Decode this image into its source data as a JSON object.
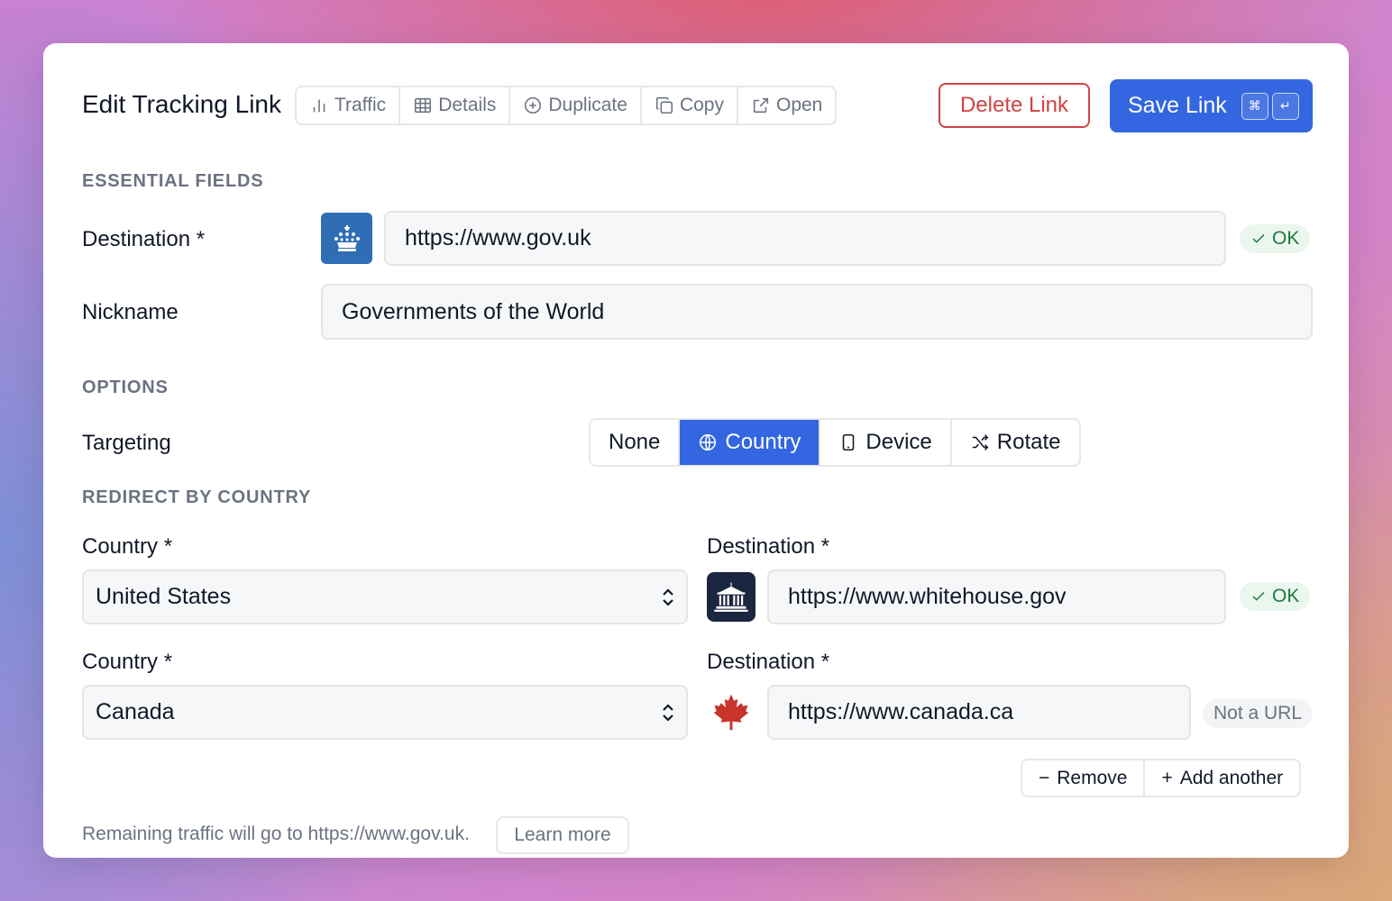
{
  "header": {
    "title": "Edit Tracking Link",
    "toolbar": [
      {
        "label": "Traffic",
        "icon": "bar-chart-icon"
      },
      {
        "label": "Details",
        "icon": "table-icon"
      },
      {
        "label": "Duplicate",
        "icon": "plus-circle-icon"
      },
      {
        "label": "Copy",
        "icon": "copy-icon"
      },
      {
        "label": "Open",
        "icon": "external-link-icon"
      }
    ],
    "delete_label": "Delete Link",
    "save_label": "Save Link",
    "save_shortcut": [
      "⌘",
      "↵"
    ]
  },
  "essential": {
    "section_title": "ESSENTIAL FIELDS",
    "destination_label": "Destination *",
    "destination_value": "https://www.gov.uk",
    "destination_status": "OK",
    "nickname_label": "Nickname",
    "nickname_value": "Governments of the World"
  },
  "options": {
    "section_title": "OPTIONS",
    "targeting_label": "Targeting",
    "targeting_options": [
      {
        "label": "None",
        "icon": ""
      },
      {
        "label": "Country",
        "icon": "globe-icon"
      },
      {
        "label": "Device",
        "icon": "phone-icon"
      },
      {
        "label": "Rotate",
        "icon": "shuffle-icon"
      }
    ],
    "targeting_selected": "Country"
  },
  "redirect": {
    "section_title": "REDIRECT BY COUNTRY",
    "rows": [
      {
        "country_label": "Country *",
        "country_value": "United States",
        "destination_label": "Destination *",
        "destination_value": "https://www.whitehouse.gov",
        "status": "OK"
      },
      {
        "country_label": "Country *",
        "country_value": "Canada",
        "destination_label": "Destination *",
        "destination_value": "https://www.canada.ca",
        "status": "Not a URL"
      }
    ],
    "remove_label": "Remove",
    "add_label": "Add another"
  },
  "footer": {
    "remaining_text": "Remaining traffic will go to https://www.gov.uk.",
    "learn_more": "Learn more"
  },
  "colors": {
    "accent": "#3366e0",
    "danger": "#d04444",
    "ok": "#1f7a3d"
  }
}
